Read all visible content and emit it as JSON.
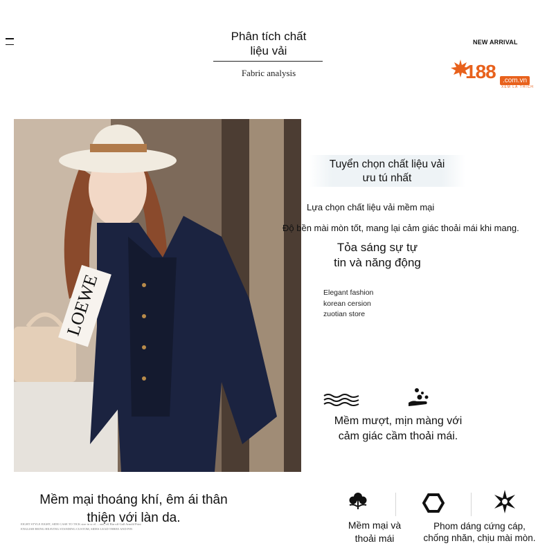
{
  "header": {
    "title_line1": "Phân tích chất",
    "title_line2": "liệu vải",
    "subtitle": "Fabric analysis",
    "badge": "NEW ARRIVAL",
    "menu_icon": "hamburger-icon"
  },
  "logo": {
    "number": "188",
    "domain": ".com.vn",
    "tagline": "XEM LÀ THÍCH",
    "accent": "#e8611c"
  },
  "photo": {
    "bag_text": "LOEWE",
    "colors": {
      "suit": "#1b2340",
      "hat": "#f1ebe0",
      "hat_band": "#b07a4a",
      "hair": "#8a4a2c"
    }
  },
  "right_panel": {
    "heading1_line1": "Tuyển chọn chất liệu vải",
    "heading1_line2": "ưu tú nhất",
    "line1": "Lựa chọn chất liệu vải mềm mại",
    "line2": "Độ bền mài mòn tốt, mang lại cảm giác thoải mái khi mang.",
    "heading2_line1": "Tỏa sáng sự tự",
    "heading2_line2": "tin và năng động",
    "english_line1": "Elegant fashion",
    "english_line2": "korean cersion",
    "english_line3": "zuotian store"
  },
  "soft_section": {
    "icons": [
      "wave-icon",
      "hand-bubbles-icon"
    ],
    "text_line1": "Mềm mượt, mịn màng với",
    "text_line2": "cảm giác cầm thoải mái."
  },
  "bottom": {
    "text_line1": "Mềm mại thoáng khí, êm ái thân",
    "text_line2": "thiện với làn da.",
    "fine_print_line1": "EIGHT STYLE EIGHT, SIDE CASE TO TICK size in sc el ... one, eff Bin uff Gall Arnold Print",
    "fine_print_line2": "ENGLISH BEING HEAVING STANDING CUSTOM, SIDES LEAD THREE AND PIN"
  },
  "features": [
    {
      "icon": "flower-icon",
      "line1": "Mềm mại và",
      "line2": "thoải mái"
    },
    {
      "icon": "hexagon-icon",
      "line1": "Phom dáng cứng cáp,",
      "line2": "chống nhăn, chịu mài mòn."
    },
    {
      "icon": "star-burst-icon"
    }
  ]
}
